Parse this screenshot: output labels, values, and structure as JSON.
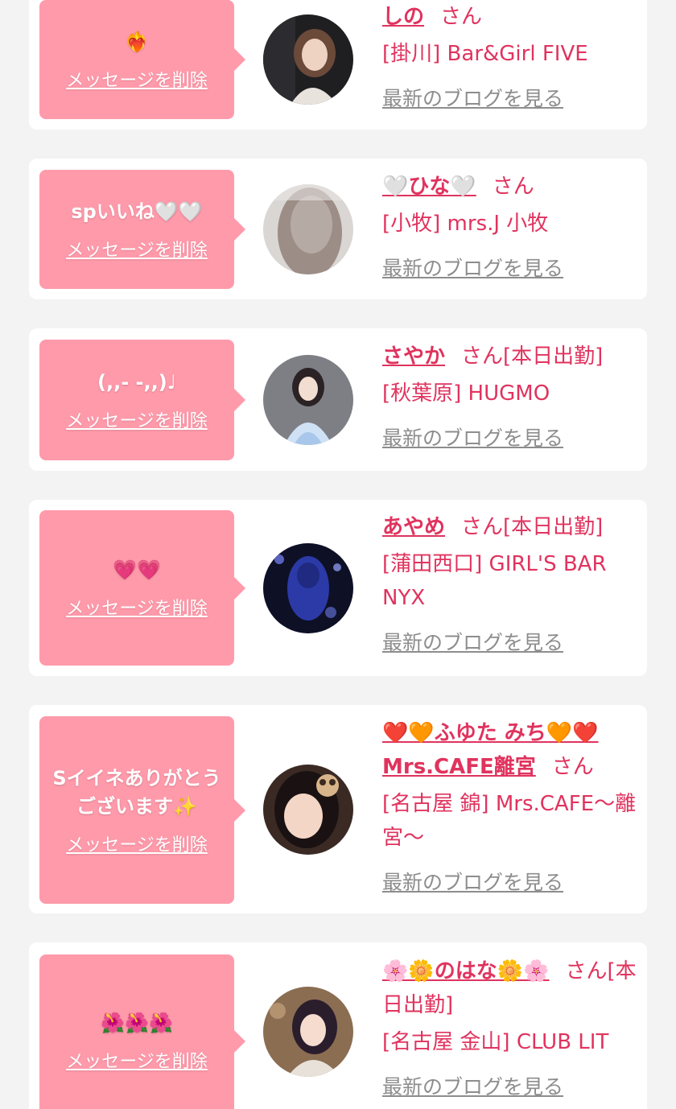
{
  "common": {
    "delete_label": "メッセージを削除",
    "san_label": "さん",
    "blog_label": "最新のブログを見る"
  },
  "colors": {
    "bubble": "#ff9aab",
    "accent": "#e0335e",
    "link_gray": "#8d8d8d",
    "background": "#f3f3f3"
  },
  "items": [
    {
      "message": "❤️‍🔥",
      "name": "しの",
      "status": "",
      "shop": "[掛川] Bar&Girl FIVE",
      "avatar_icon": "user-avatar-photo"
    },
    {
      "message": "spいいね🤍🤍",
      "name": "🤍ひな🤍",
      "status": "",
      "shop": "[小牧] mrs.J 小牧",
      "avatar_icon": "user-avatar-photo"
    },
    {
      "message": "(,,- -,,)♩",
      "name": "さやか",
      "status": "[本日出勤]",
      "shop": "[秋葉原] HUGMO",
      "avatar_icon": "user-avatar-photo"
    },
    {
      "message": "💗💗",
      "name": "あやめ",
      "status": "[本日出勤]",
      "shop": "[蒲田西口] GIRL'S BAR NYX",
      "avatar_icon": "user-avatar-photo"
    },
    {
      "message": "Sイイネありがとうございます✨",
      "name": "❤️🧡ふゆた みち🧡❤️Mrs.CAFE離宮",
      "status": "",
      "shop": "[名古屋 錦] Mrs.CAFE〜離宮〜",
      "avatar_icon": "user-avatar-photo"
    },
    {
      "message": "🌺🌺🌺",
      "name": "🌸🌼のはな🌼🌸",
      "status": "[本日出勤]",
      "shop": "[名古屋 金山] CLUB LIT",
      "avatar_icon": "user-avatar-photo"
    }
  ]
}
